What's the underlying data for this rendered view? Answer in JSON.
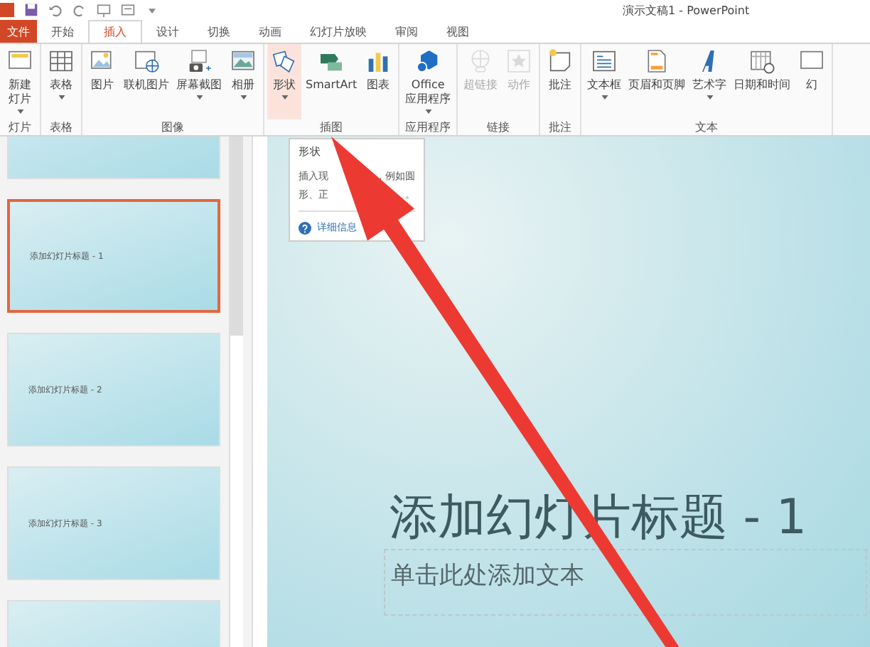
{
  "window": {
    "title": "演示文稿1 - PowerPoint"
  },
  "tabs": [
    {
      "label": "文件",
      "kind": "file",
      "selected": false
    },
    {
      "label": "开始",
      "kind": "tab",
      "selected": false
    },
    {
      "label": "插入",
      "kind": "tab",
      "selected": true
    },
    {
      "label": "设计",
      "kind": "tab",
      "selected": false
    },
    {
      "label": "切换",
      "kind": "tab",
      "selected": false
    },
    {
      "label": "动画",
      "kind": "tab",
      "selected": false
    },
    {
      "label": "幻灯片放映",
      "kind": "tab",
      "selected": false
    },
    {
      "label": "审阅",
      "kind": "tab",
      "selected": false
    },
    {
      "label": "视图",
      "kind": "tab",
      "selected": false
    }
  ],
  "ribbon": {
    "groups": [
      {
        "label": "灯片",
        "buttons": [
          {
            "lines": [
              "新建",
              "灯片"
            ],
            "dropdown": true,
            "disabled": false,
            "pressed": false
          }
        ]
      },
      {
        "label": "表格",
        "buttons": [
          {
            "lines": [
              "表格"
            ],
            "dropdown": true,
            "disabled": false,
            "pressed": false
          }
        ]
      },
      {
        "label": "图像",
        "buttons": [
          {
            "lines": [
              "图片"
            ],
            "dropdown": false,
            "disabled": false,
            "pressed": false
          },
          {
            "lines": [
              "联机图片"
            ],
            "dropdown": false,
            "disabled": false,
            "pressed": false
          },
          {
            "lines": [
              "屏幕截图"
            ],
            "dropdown": true,
            "disabled": false,
            "pressed": false
          },
          {
            "lines": [
              "相册"
            ],
            "dropdown": true,
            "disabled": false,
            "pressed": false
          }
        ]
      },
      {
        "label": "插图",
        "buttons": [
          {
            "lines": [
              "形状"
            ],
            "dropdown": true,
            "disabled": false,
            "pressed": true
          },
          {
            "lines": [
              "SmartArt"
            ],
            "dropdown": false,
            "disabled": false,
            "pressed": false
          },
          {
            "lines": [
              "图表"
            ],
            "dropdown": false,
            "disabled": false,
            "pressed": false
          }
        ]
      },
      {
        "label": "应用程序",
        "buttons": [
          {
            "lines": [
              "Office",
              "应用程序"
            ],
            "dropdown": true,
            "disabled": false,
            "pressed": false
          }
        ]
      },
      {
        "label": "链接",
        "buttons": [
          {
            "lines": [
              "超链接"
            ],
            "dropdown": false,
            "disabled": true,
            "pressed": false
          },
          {
            "lines": [
              "动作"
            ],
            "dropdown": false,
            "disabled": true,
            "pressed": false
          }
        ]
      },
      {
        "label": "批注",
        "buttons": [
          {
            "lines": [
              "批注"
            ],
            "dropdown": false,
            "disabled": false,
            "pressed": false
          }
        ]
      },
      {
        "label": "文本",
        "buttons": [
          {
            "lines": [
              "文本框"
            ],
            "dropdown": true,
            "disabled": false,
            "pressed": false
          },
          {
            "lines": [
              "页眉和页脚"
            ],
            "dropdown": false,
            "disabled": false,
            "pressed": false
          },
          {
            "lines": [
              "艺术字"
            ],
            "dropdown": true,
            "disabled": false,
            "pressed": false
          },
          {
            "lines": [
              "日期和时间"
            ],
            "dropdown": false,
            "disabled": false,
            "pressed": false
          },
          {
            "lines": [
              "幻"
            ],
            "dropdown": false,
            "disabled": false,
            "pressed": false
          }
        ]
      }
    ]
  },
  "tooltip": {
    "title": "形状",
    "description": [
      [
        "插入现",
        "，例如圆"
      ],
      [
        "形、正",
        "。"
      ]
    ],
    "link": "详细信息"
  },
  "slides": [
    {
      "selected": false
    },
    {
      "title": "添加幻灯片标题 - 1",
      "selected": true
    },
    {
      "title": "添加幻灯片标题 - 2",
      "selected": false
    },
    {
      "title": "添加幻灯片标题 - 3",
      "selected": false
    },
    {
      "selected": false
    }
  ],
  "slide": {
    "title": "添加幻灯片标题 - 1",
    "placeholder": "单击此处添加文本"
  }
}
